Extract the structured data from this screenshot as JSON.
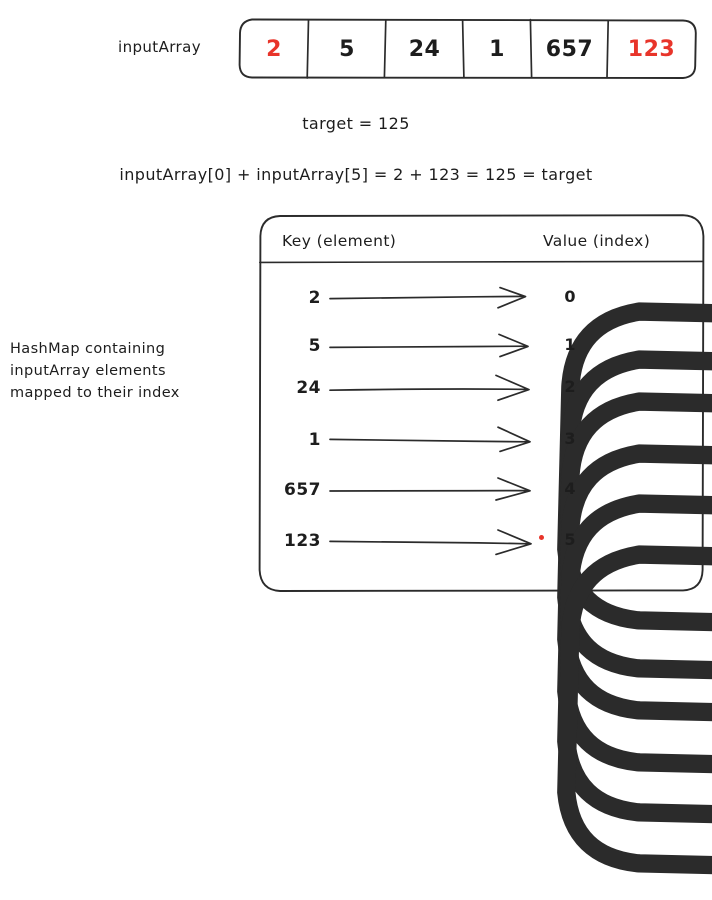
{
  "colors": {
    "ink": "#1d1d1d",
    "highlight": "#e8342a",
    "background": "#ffffff"
  },
  "array": {
    "label": "inputArray",
    "cells": [
      {
        "value": "2",
        "highlighted": true
      },
      {
        "value": "5",
        "highlighted": false
      },
      {
        "value": "24",
        "highlighted": false
      },
      {
        "value": "1",
        "highlighted": false
      },
      {
        "value": "657",
        "highlighted": false
      },
      {
        "value": "123",
        "highlighted": true
      }
    ]
  },
  "target_line": "target = 125",
  "equation_line": "inputArray[0] + inputArray[5] = 2 + 123 = 125 = target",
  "caption": {
    "line1": "HashMap containing",
    "line2": "inputArray elements",
    "line3": "mapped to their index"
  },
  "hashmap": {
    "header_key": "Key (element)",
    "header_value": "Value (index)",
    "rows": [
      {
        "key": "2",
        "value": "0",
        "marked": false
      },
      {
        "key": "5",
        "value": "1",
        "marked": false
      },
      {
        "key": "24",
        "value": "2",
        "marked": false
      },
      {
        "key": "1",
        "value": "3",
        "marked": false
      },
      {
        "key": "657",
        "value": "4",
        "marked": false
      },
      {
        "key": "123",
        "value": "5",
        "marked": true
      }
    ]
  }
}
